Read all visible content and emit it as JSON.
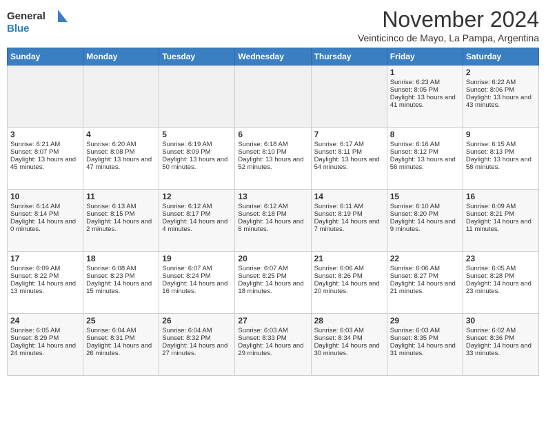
{
  "header": {
    "logo_general": "General",
    "logo_blue": "Blue",
    "month": "November 2024",
    "location": "Veinticinco de Mayo, La Pampa, Argentina"
  },
  "weekdays": [
    "Sunday",
    "Monday",
    "Tuesday",
    "Wednesday",
    "Thursday",
    "Friday",
    "Saturday"
  ],
  "weeks": [
    [
      {
        "day": "",
        "empty": true
      },
      {
        "day": "",
        "empty": true
      },
      {
        "day": "",
        "empty": true
      },
      {
        "day": "",
        "empty": true
      },
      {
        "day": "",
        "empty": true
      },
      {
        "day": "1",
        "sunrise": "Sunrise: 6:23 AM",
        "sunset": "Sunset: 8:05 PM",
        "daylight": "Daylight: 13 hours and 41 minutes."
      },
      {
        "day": "2",
        "sunrise": "Sunrise: 6:22 AM",
        "sunset": "Sunset: 8:06 PM",
        "daylight": "Daylight: 13 hours and 43 minutes."
      }
    ],
    [
      {
        "day": "3",
        "sunrise": "Sunrise: 6:21 AM",
        "sunset": "Sunset: 8:07 PM",
        "daylight": "Daylight: 13 hours and 45 minutes."
      },
      {
        "day": "4",
        "sunrise": "Sunrise: 6:20 AM",
        "sunset": "Sunset: 8:08 PM",
        "daylight": "Daylight: 13 hours and 47 minutes."
      },
      {
        "day": "5",
        "sunrise": "Sunrise: 6:19 AM",
        "sunset": "Sunset: 8:09 PM",
        "daylight": "Daylight: 13 hours and 50 minutes."
      },
      {
        "day": "6",
        "sunrise": "Sunrise: 6:18 AM",
        "sunset": "Sunset: 8:10 PM",
        "daylight": "Daylight: 13 hours and 52 minutes."
      },
      {
        "day": "7",
        "sunrise": "Sunrise: 6:17 AM",
        "sunset": "Sunset: 8:11 PM",
        "daylight": "Daylight: 13 hours and 54 minutes."
      },
      {
        "day": "8",
        "sunrise": "Sunrise: 6:16 AM",
        "sunset": "Sunset: 8:12 PM",
        "daylight": "Daylight: 13 hours and 56 minutes."
      },
      {
        "day": "9",
        "sunrise": "Sunrise: 6:15 AM",
        "sunset": "Sunset: 8:13 PM",
        "daylight": "Daylight: 13 hours and 58 minutes."
      }
    ],
    [
      {
        "day": "10",
        "sunrise": "Sunrise: 6:14 AM",
        "sunset": "Sunset: 8:14 PM",
        "daylight": "Daylight: 14 hours and 0 minutes."
      },
      {
        "day": "11",
        "sunrise": "Sunrise: 6:13 AM",
        "sunset": "Sunset: 8:15 PM",
        "daylight": "Daylight: 14 hours and 2 minutes."
      },
      {
        "day": "12",
        "sunrise": "Sunrise: 6:12 AM",
        "sunset": "Sunset: 8:17 PM",
        "daylight": "Daylight: 14 hours and 4 minutes."
      },
      {
        "day": "13",
        "sunrise": "Sunrise: 6:12 AM",
        "sunset": "Sunset: 8:18 PM",
        "daylight": "Daylight: 14 hours and 6 minutes."
      },
      {
        "day": "14",
        "sunrise": "Sunrise: 6:11 AM",
        "sunset": "Sunset: 8:19 PM",
        "daylight": "Daylight: 14 hours and 7 minutes."
      },
      {
        "day": "15",
        "sunrise": "Sunrise: 6:10 AM",
        "sunset": "Sunset: 8:20 PM",
        "daylight": "Daylight: 14 hours and 9 minutes."
      },
      {
        "day": "16",
        "sunrise": "Sunrise: 6:09 AM",
        "sunset": "Sunset: 8:21 PM",
        "daylight": "Daylight: 14 hours and 11 minutes."
      }
    ],
    [
      {
        "day": "17",
        "sunrise": "Sunrise: 6:09 AM",
        "sunset": "Sunset: 8:22 PM",
        "daylight": "Daylight: 14 hours and 13 minutes."
      },
      {
        "day": "18",
        "sunrise": "Sunrise: 6:08 AM",
        "sunset": "Sunset: 8:23 PM",
        "daylight": "Daylight: 14 hours and 15 minutes."
      },
      {
        "day": "19",
        "sunrise": "Sunrise: 6:07 AM",
        "sunset": "Sunset: 8:24 PM",
        "daylight": "Daylight: 14 hours and 16 minutes."
      },
      {
        "day": "20",
        "sunrise": "Sunrise: 6:07 AM",
        "sunset": "Sunset: 8:25 PM",
        "daylight": "Daylight: 14 hours and 18 minutes."
      },
      {
        "day": "21",
        "sunrise": "Sunrise: 6:06 AM",
        "sunset": "Sunset: 8:26 PM",
        "daylight": "Daylight: 14 hours and 20 minutes."
      },
      {
        "day": "22",
        "sunrise": "Sunrise: 6:06 AM",
        "sunset": "Sunset: 8:27 PM",
        "daylight": "Daylight: 14 hours and 21 minutes."
      },
      {
        "day": "23",
        "sunrise": "Sunrise: 6:05 AM",
        "sunset": "Sunset: 8:28 PM",
        "daylight": "Daylight: 14 hours and 23 minutes."
      }
    ],
    [
      {
        "day": "24",
        "sunrise": "Sunrise: 6:05 AM",
        "sunset": "Sunset: 8:29 PM",
        "daylight": "Daylight: 14 hours and 24 minutes."
      },
      {
        "day": "25",
        "sunrise": "Sunrise: 6:04 AM",
        "sunset": "Sunset: 8:31 PM",
        "daylight": "Daylight: 14 hours and 26 minutes."
      },
      {
        "day": "26",
        "sunrise": "Sunrise: 6:04 AM",
        "sunset": "Sunset: 8:32 PM",
        "daylight": "Daylight: 14 hours and 27 minutes."
      },
      {
        "day": "27",
        "sunrise": "Sunrise: 6:03 AM",
        "sunset": "Sunset: 8:33 PM",
        "daylight": "Daylight: 14 hours and 29 minutes."
      },
      {
        "day": "28",
        "sunrise": "Sunrise: 6:03 AM",
        "sunset": "Sunset: 8:34 PM",
        "daylight": "Daylight: 14 hours and 30 minutes."
      },
      {
        "day": "29",
        "sunrise": "Sunrise: 6:03 AM",
        "sunset": "Sunset: 8:35 PM",
        "daylight": "Daylight: 14 hours and 31 minutes."
      },
      {
        "day": "30",
        "sunrise": "Sunrise: 6:02 AM",
        "sunset": "Sunset: 8:36 PM",
        "daylight": "Daylight: 14 hours and 33 minutes."
      }
    ]
  ]
}
